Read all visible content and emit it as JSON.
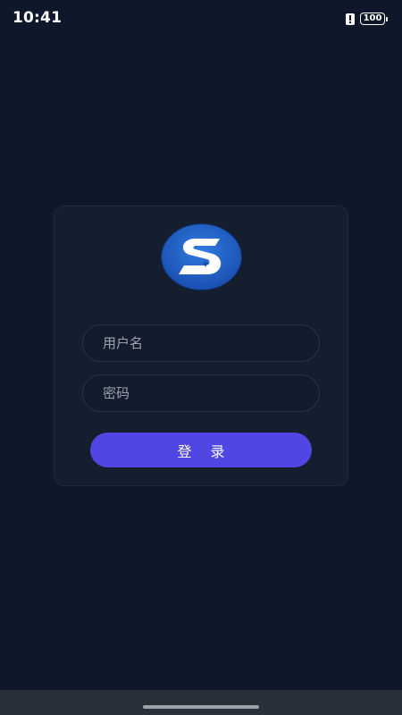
{
  "status_bar": {
    "time": "10:41",
    "battery_level": "100",
    "icons": [
      "alert-icon",
      "battery-icon"
    ]
  },
  "login": {
    "logo": "s-logo",
    "username_placeholder": "用户名",
    "password_placeholder": "密码",
    "submit_label": "登 录"
  },
  "colors": {
    "background": "#0f172a",
    "card": "#151e2e",
    "primary": "#5046e4",
    "logo_blue": "#1f5fc4"
  }
}
